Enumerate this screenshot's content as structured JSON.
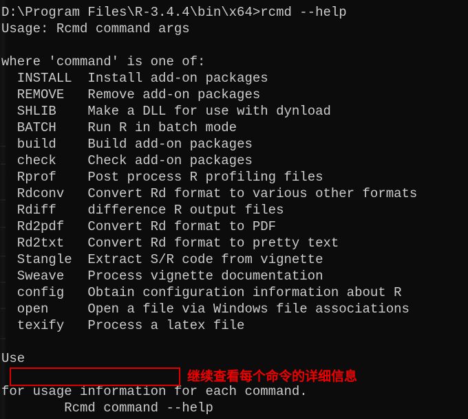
{
  "terminal": {
    "prompt_line": "D:\\Program Files\\R-3.4.4\\bin\\x64>rcmd --help",
    "usage_line": "Usage: Rcmd command args",
    "blank": "",
    "where_line": "where 'command' is one of:",
    "commands": [
      {
        "name": "  INSTALL",
        "desc": "  Install add-on packages"
      },
      {
        "name": "  REMOVE",
        "desc": "   Remove add-on packages"
      },
      {
        "name": "  SHLIB",
        "desc": "    Make a DLL for use with dynload"
      },
      {
        "name": "  BATCH",
        "desc": "    Run R in batch mode"
      },
      {
        "name": "  build",
        "desc": "    Build add-on packages"
      },
      {
        "name": "  check",
        "desc": "    Check add-on packages"
      },
      {
        "name": "  Rprof",
        "desc": "    Post process R profiling files"
      },
      {
        "name": "  Rdconv",
        "desc": "   Convert Rd format to various other formats"
      },
      {
        "name": "  Rdiff",
        "desc": "    difference R output files"
      },
      {
        "name": "  Rd2pdf",
        "desc": "   Convert Rd format to PDF"
      },
      {
        "name": "  Rd2txt",
        "desc": "   Convert Rd format to pretty text"
      },
      {
        "name": "  Stangle",
        "desc": "  Extract S/R code from vignette"
      },
      {
        "name": "  Sweave",
        "desc": "   Process vignette documentation"
      },
      {
        "name": "  config",
        "desc": "   Obtain configuration information about R"
      },
      {
        "name": "  open",
        "desc": "     Open a file via Windows file associations"
      },
      {
        "name": "  texify",
        "desc": "   Process a latex file"
      }
    ],
    "use_line": "Use",
    "highlighted_command": "  Rcmd command --help",
    "for_usage_line": "for usage information for each command.",
    "annotation_cn": "继续查看每个命令的详细信息",
    "colors": {
      "background": "#0c0c0c",
      "text": "#cccccc",
      "annotation": "#ee0000",
      "highlight_box": "#e00000"
    }
  }
}
